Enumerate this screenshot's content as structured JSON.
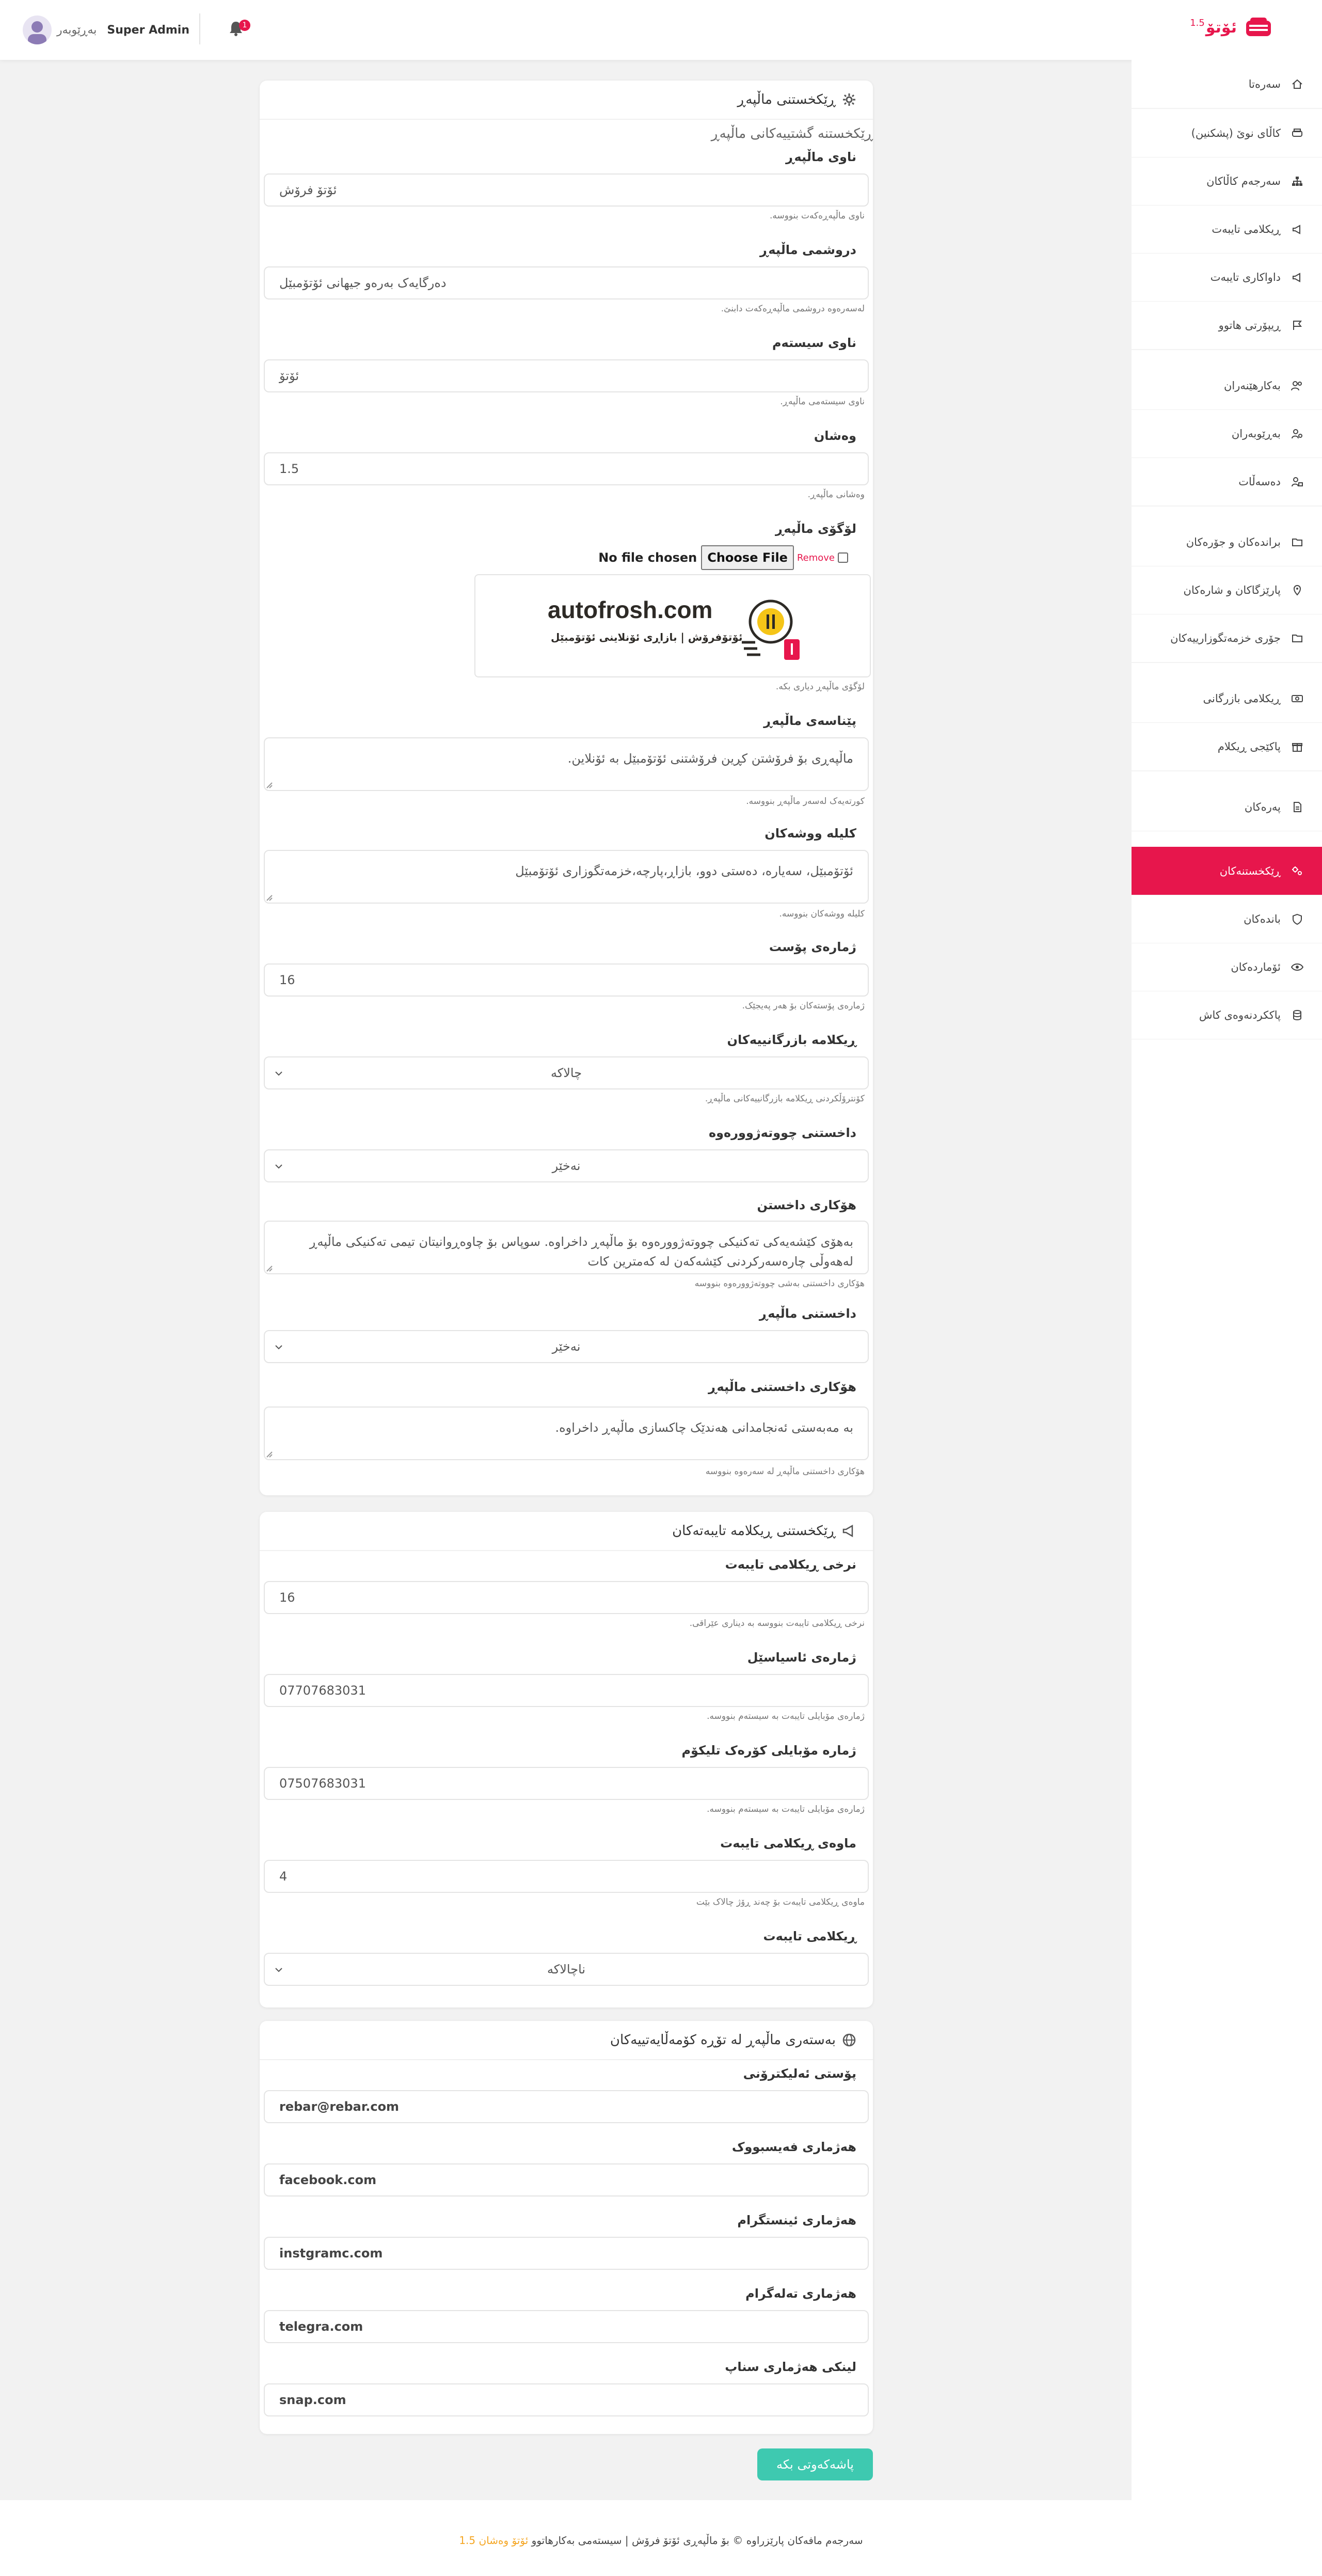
{
  "header": {
    "logo_text": "ئۆتۆ",
    "logo_version": "1.5",
    "user_name": "Super Admin",
    "user_role": "بەڕێوبەر",
    "notification_count": "1",
    "accent_color": "#e7164c"
  },
  "sidebar": {
    "items": [
      {
        "label": "سەرەتا",
        "icon": "home-icon"
      },
      {
        "label": "کاڵای نوێ (پشکنین)",
        "icon": "car-icon"
      },
      {
        "label": "سەرجەم کاڵاکان",
        "icon": "sitemap-icon"
      },
      {
        "label": "ڕیکلامی تایبەت",
        "icon": "megaphone-icon"
      },
      {
        "label": "داواکاری تایبەت",
        "icon": "megaphone-icon"
      },
      {
        "label": "ڕیپۆرتی هاتوو",
        "icon": "flag-icon"
      },
      {
        "label": "بەکارهێنەران",
        "icon": "users-icon"
      },
      {
        "label": "بەڕێوبەران",
        "icon": "user-gear-icon"
      },
      {
        "label": "دەسەڵات",
        "icon": "user-lock-icon"
      },
      {
        "label": "براندەکان و جۆرەکان",
        "icon": "folder-icon"
      },
      {
        "label": "پارێزگاکان و شارەکان",
        "icon": "map-pin-icon"
      },
      {
        "label": "جۆری خزمەتگوزارییەکان",
        "icon": "folder-icon"
      },
      {
        "label": "ڕیکلامی بازرگانی",
        "icon": "money-icon"
      },
      {
        "label": "پاکێجی ڕیکلام",
        "icon": "gift-icon"
      },
      {
        "label": "پەرەکان",
        "icon": "page-icon"
      },
      {
        "label": "ڕێکخستنەکان",
        "icon": "settings-icon"
      },
      {
        "label": "باندەکان",
        "icon": "shield-icon"
      },
      {
        "label": "ئۆماردەکان",
        "icon": "eye-icon"
      },
      {
        "label": "پاککردنەوەی کاش",
        "icon": "database-icon"
      }
    ]
  },
  "general": {
    "title": "ڕێکخستنی ماڵپەڕ",
    "subtitle": "ڕێکخستنە گشتییەکانی ماڵپەڕ",
    "site_name": {
      "label": "ناوی ماڵپەڕ",
      "value": "ئۆتۆ فرۆش",
      "help": "ناوی ماڵپەڕەکەت بنووسە."
    },
    "site_slogan": {
      "label": "دروشمی ماڵپەڕ",
      "value": "دەرگایەک بەرەو جیهانی ئۆتۆمبێل",
      "help": "لەسەرەوە دروشمی ماڵپەڕەکەت دابنێ."
    },
    "system_name": {
      "label": "ناوی سیستەم",
      "value": "ئۆتۆ",
      "help": "ناوی سیستەمی ماڵپەڕ."
    },
    "version": {
      "label": "وەشان",
      "value": "1.5",
      "help": "وەشانی ماڵپەڕ."
    },
    "logo": {
      "label": "لۆگۆی ماڵپەڕ",
      "no_file": "No file chosen",
      "choose_file": "Choose File",
      "remove": "Remove",
      "help": "لۆگۆی ماڵپەڕ دیاری بکە.",
      "brand_name": "autofrosh.com",
      "brand_tagline": "ئۆتۆفرۆش | بازاڕی ئۆنلاینی ئۆتۆمبێل"
    },
    "description": {
      "label": "پێناسەی ماڵپەڕ",
      "value": "ماڵپەڕی بۆ فرۆشتن کڕین فرۆشتنی ئۆتۆمبێل بە ئۆنلاین.",
      "help": "کورتەیەک لەسەر ماڵپەڕ بنووسە."
    },
    "keywords": {
      "label": "کلیلە ووشەکان",
      "value": "ئۆتۆمبێل، سەیارە، دەستی دوو، بازاڕ،پارچە،خزمەتگوزاری ئۆتۆمبێل",
      "help": "کلیلە ووشەکان بنووسە."
    },
    "post_count": {
      "label": "ژمارەی پۆست",
      "value": "16",
      "help": "ژمارەی پۆستەکان بۆ هەر پەیجێک."
    },
    "commercial_ads": {
      "label": "ڕیکلامە بازرگانییەکان",
      "value": "چالاکە",
      "help": "کۆنترۆڵکردنی ڕیکلامە بازرگانییەکانی ماڵپەڕ."
    },
    "shutdown_section": {
      "label": "داخستنی چووتەژوورەوە",
      "value": "نەخێر"
    },
    "shutdown_reason": {
      "label": "هۆکاری داخستن",
      "value": "بەهۆی کێشەیەکی تەکنیکی چووتەژوورەوە بۆ ماڵپەڕ داخراوە. سوپاس بۆ چاوەڕوانیتان تیمی تەکنیکی ماڵپەڕ لەهەوڵی چارەسەرکردنی کێشەکەن لە کەمترین کات",
      "help": "هۆکاری داخستنی بەشی چووتەژوورەوە بنووسە"
    },
    "site_shutdown": {
      "label": "داخستنی ماڵپەڕ",
      "value": "نەخێر"
    },
    "site_shutdown_reason": {
      "label": "هۆکاری داخستنی ماڵپەڕ",
      "value": "بە مەبەستی ئەنجامدانی هەندێک چاکسازی ماڵپەڕ داخراوە.",
      "help": "هۆکاری داخستنی ماڵپەڕ لە سەرەوە بنووسە"
    }
  },
  "special_ads": {
    "title": "ڕێکخستنی ڕیکلامە تایبەتەکان",
    "price": {
      "label": "نرخی ڕیکلامی تایبەت",
      "value": "16",
      "help": "نرخی ڕیکلامی تایبەت بنووسە بە دیناری عێراقی."
    },
    "asiacell": {
      "label": "ژمارەی ئاسیاسێل",
      "value": "07707683031",
      "help": "ژمارەی مۆبایلی تایبەت بە سیستەم بنووسە."
    },
    "korek": {
      "label": "ژمارە مۆبایلی کۆرەک تلیکۆم",
      "value": "07507683031",
      "help": "ژمارەی مۆبایلی تایبەت بە سیستەم بنووسە."
    },
    "duration": {
      "label": "ماوەی ڕیکلامی تایبەت",
      "value": "4",
      "help": "ماوەی ڕیکلامی تایبەت بۆ چەند ڕۆژ چالاک بێت"
    },
    "status": {
      "label": "ڕیکلامی تایبەت",
      "value": "ناچالاکە"
    }
  },
  "social": {
    "title": "بەستەری ماڵپەڕ لە تۆڕە کۆمەڵایەتییەکان",
    "email": {
      "label": "پۆستی ئەلیکترۆنی",
      "value": "rebar@rebar.com"
    },
    "facebook": {
      "label": "هەژماری فەیسبووک",
      "value": "facebook.com"
    },
    "instagram": {
      "label": "هەژماری ئینستگرام",
      "value": "instgramc.com"
    },
    "telegram": {
      "label": "هەژماری تەلەگرام",
      "value": "telegra.com"
    },
    "snapchat": {
      "label": "لینکی هەژماری سناپ",
      "value": "snap.com"
    }
  },
  "save_button": "پاشەکەوتی بکە",
  "footer": {
    "text": "سەرجەم مافەکان پارێزراوە © بۆ ماڵپەڕی ئۆتۆ فرۆش | سیستەمی بەکارهاتوو",
    "highlight": "ئۆتۆ وەشان 1.5"
  }
}
